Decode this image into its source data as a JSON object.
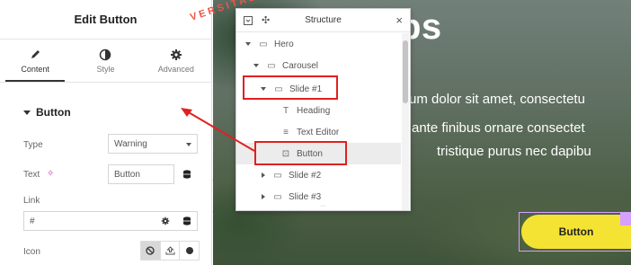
{
  "panel": {
    "title": "Edit Button",
    "tabs": [
      {
        "label": "Content",
        "icon": "pencil-icon",
        "active": true
      },
      {
        "label": "Style",
        "icon": "half-circle-icon",
        "active": false
      },
      {
        "label": "Advanced",
        "icon": "gear-icon",
        "active": false
      }
    ],
    "section_title": "Button",
    "type_label": "Type",
    "type_value": "Warning",
    "text_label": "Text",
    "text_value": "Button",
    "link_label": "Link",
    "link_value": "#",
    "icon_label": "Icon",
    "collapse_glyph": "‹"
  },
  "hero": {
    "title": "Lorem Ips",
    "arc_text": "VERSITAS",
    "lines": [
      "um dolor sit amet, consectetu",
      "ante finibus ornare consectet",
      "tristique purus nec dapibu"
    ],
    "button_label": "Button"
  },
  "structure": {
    "title": "Structure",
    "close_glyph": "×",
    "tree": [
      {
        "label": "Hero",
        "icon": "section-icon",
        "expanded": true
      },
      {
        "label": "Carousel",
        "icon": "carousel-icon",
        "expanded": true
      },
      {
        "label": "Slide #1",
        "icon": "container-icon",
        "expanded": true
      },
      {
        "label": "Heading",
        "icon": "heading-icon"
      },
      {
        "label": "Text Editor",
        "icon": "text-editor-icon"
      },
      {
        "label": "Button",
        "icon": "button-icon",
        "selected": true
      },
      {
        "label": "Slide #2",
        "icon": "container-icon",
        "expanded": false
      },
      {
        "label": "Slide #3",
        "icon": "container-icon",
        "expanded": false
      }
    ],
    "resize_glyph": "···"
  },
  "colors": {
    "annotation_red": "#e02020",
    "hero_button": "#f4e332",
    "selection_outline": "#d6a0ff"
  }
}
